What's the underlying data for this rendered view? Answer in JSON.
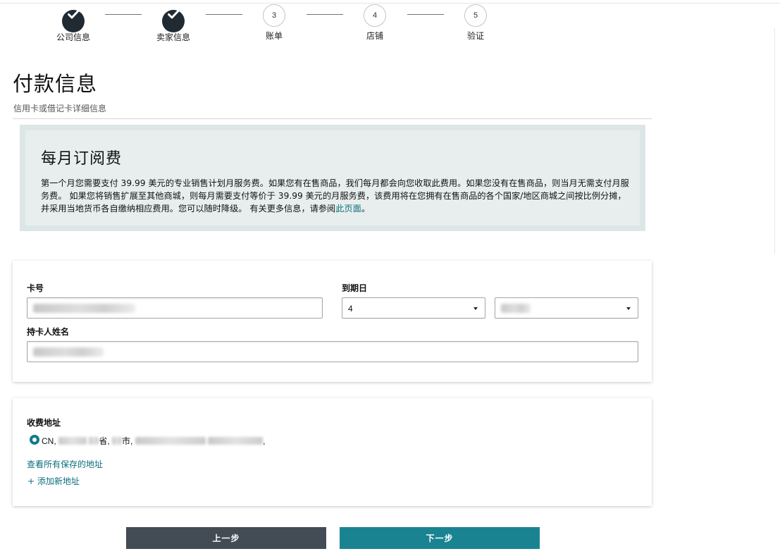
{
  "stepper": {
    "steps": [
      {
        "label": "公司信息",
        "state": "done"
      },
      {
        "label": "卖家信息",
        "state": "done"
      },
      {
        "number": "3",
        "label": "账单",
        "state": "todo"
      },
      {
        "number": "4",
        "label": "店铺",
        "state": "todo"
      },
      {
        "number": "5",
        "label": "验证",
        "state": "todo"
      }
    ]
  },
  "header": {
    "title": "付款信息",
    "subtitle": "信用卡或借记卡详细信息"
  },
  "info": {
    "title": "每月订阅费",
    "text": "第一个月您需要支付 39.99 美元的专业销售计划月服务费。如果您有在售商品，我们每月都会向您收取此费用。如果您没有在售商品，则当月无需支付月服务费。 如果您将销售扩展至其他商城，则每月需要支付等价于 39.99 美元的月服务费，该费用将在您拥有在售商品的各个国家/地区商城之间按比例分摊，并采用当地货币各自缴纳相应费用。您可以随时降级。 有关更多信息，请参阅",
    "link": "此页面",
    "end": "。"
  },
  "payment": {
    "card_number_label": "卡号",
    "expiry_label": "到期日",
    "expiry_month": "4",
    "expiry_year": "",
    "holder_label": "持卡人姓名"
  },
  "address": {
    "label": "收费地址",
    "country_prefix": "CN,",
    "province_suffix": "省,",
    "city_suffix": "市,",
    "trailing": ",",
    "view_all_link": "查看所有保存的地址",
    "add_new_link": "+ 添加新地址"
  },
  "buttons": {
    "prev": "上一步",
    "next": "下一步"
  },
  "colors": {
    "accent": "#1a8391",
    "link": "#0a6e7c",
    "prev_button": "#434b55",
    "step_done": "#1f2a33"
  }
}
